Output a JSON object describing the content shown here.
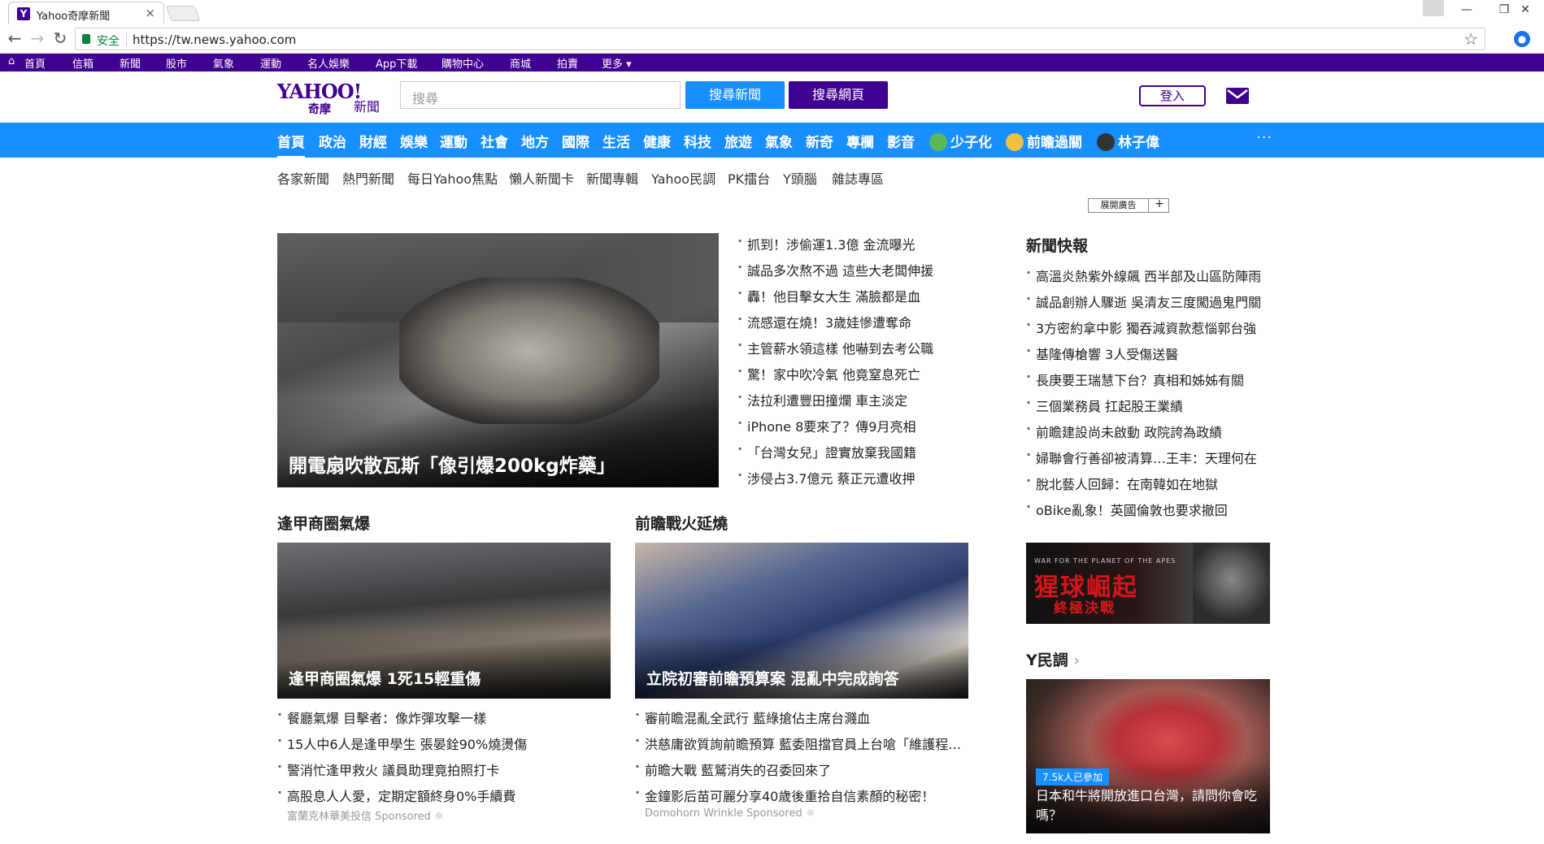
{
  "browser": {
    "tab_title": "Yahoo奇摩新聞",
    "tab_close": "×",
    "secure_label": "安全",
    "url": "https://tw.news.yahoo.com",
    "nav_back": "←",
    "nav_forward": "→",
    "nav_reload": "↻",
    "bookmark_star": "☆",
    "win_min": "—",
    "win_max": "❐",
    "win_close": "✕"
  },
  "topbar": {
    "home": "首頁",
    "items": [
      "信箱",
      "新聞",
      "股市",
      "氣象",
      "運動",
      "名人娛樂",
      "App下載",
      "購物中心",
      "商城",
      "拍賣",
      "更多 ▾"
    ]
  },
  "header": {
    "logo_text": "YAHOO!",
    "logo_sub": "奇摩",
    "logo_section": "新聞",
    "search_placeholder": "搜尋",
    "search_news_btn": "搜尋新聞",
    "search_web_btn": "搜尋網頁",
    "login_btn": "登入"
  },
  "bluenav": {
    "items": [
      "首頁",
      "政治",
      "財經",
      "娛樂",
      "運動",
      "社會",
      "地方",
      "國際",
      "生活",
      "健康",
      "科技",
      "旅遊",
      "氣象",
      "新奇",
      "專欄",
      "影音"
    ],
    "people": [
      "少子化",
      "前瞻過關",
      "林子偉"
    ],
    "more": "···"
  },
  "subnav": [
    "各家新聞",
    "熱門新聞",
    "每日Yahoo焦點",
    "懶人新聞卡",
    "新聞專輯",
    "Yahoo民調",
    "PK擂台",
    "Y頭腦",
    "雜誌專區"
  ],
  "ad_toggle": {
    "label": "展開廣告",
    "plus": "+"
  },
  "hero": {
    "caption": "開電扇吹散瓦斯「像引爆200kg炸藥」",
    "headlines": [
      "抓到！涉偷運1.3億 金流曝光",
      "誠品多次熬不過 這些大老闆伸援",
      "轟！他目擊女大生 滿臉都是血",
      "流感還在燒！3歲娃慘遭奪命",
      "主管薪水領這樣 他嚇到去考公職",
      "驚！家中吹冷氣 他竟窒息死亡",
      "法拉利遭豐田撞爛 車主淡定",
      "iPhone 8要來了？傳9月亮相",
      "「台灣女兒」證實放棄我國籍",
      "涉侵占3.7億元 蔡正元遭收押"
    ]
  },
  "section_left": {
    "title": "逢甲商圈氣爆",
    "caption": "逢甲商圈氣爆 1死15輕重傷",
    "items": [
      "餐廳氣爆 目擊者：像炸彈攻擊一樣",
      "15人中6人是逢甲學生 張晏銓90%燒燙傷",
      "警消忙逢甲救火 議員助理竟拍照打卡",
      "高股息人人愛，定期定額終身0%手續費"
    ],
    "sponsor": "富蘭克林華美投信 Sponsored ☼"
  },
  "section_right": {
    "title": "前瞻戰火延燒",
    "caption": "立院初審前瞻預算案 混亂中完成詢答",
    "items": [
      "審前瞻混亂全武行 藍綠搶佔主席台濺血",
      "洪慈庸欲質詢前瞻預算 藍委阻擋官員上台嗆「維護程…",
      "前瞻大戰 藍鷲消失的召委回來了",
      "金鐘影后苗可麗分享40歲後重拾自信素顏的秘密！"
    ],
    "sponsor": "Domohorn Wrinkle Sponsored ☼"
  },
  "flash": {
    "title": "新聞快報",
    "items": [
      "高溫炎熱紫外線飆 西半部及山區防陣雨",
      "誠品創辦人驟逝 吳清友三度闖過鬼門關",
      "3方密約拿中影 獨吞減資款惹惱郭台強",
      "基隆傳槍響 3人受傷送醫",
      "長庚要王瑞慧下台？真相和姊姊有關",
      "三個業務員 扛起股王業績",
      "前瞻建設尚未啟動 政院誇為政績",
      "婦聯會行善卻被清算…王丰：天理何在",
      "脫北藝人回歸：在南韓如在地獄",
      "oBike亂象！英國倫敦也要求撤回"
    ]
  },
  "ad_banner": {
    "line1": "WAR FOR THE PLANET OF THE APES",
    "line2": "猩球崛起",
    "line3": "終極決戰"
  },
  "poll": {
    "title": "Y民調",
    "chevron": "›",
    "participants": "7.5k人已參加",
    "question": "日本和牛將開放進口台灣，請問你會吃嗎？"
  }
}
